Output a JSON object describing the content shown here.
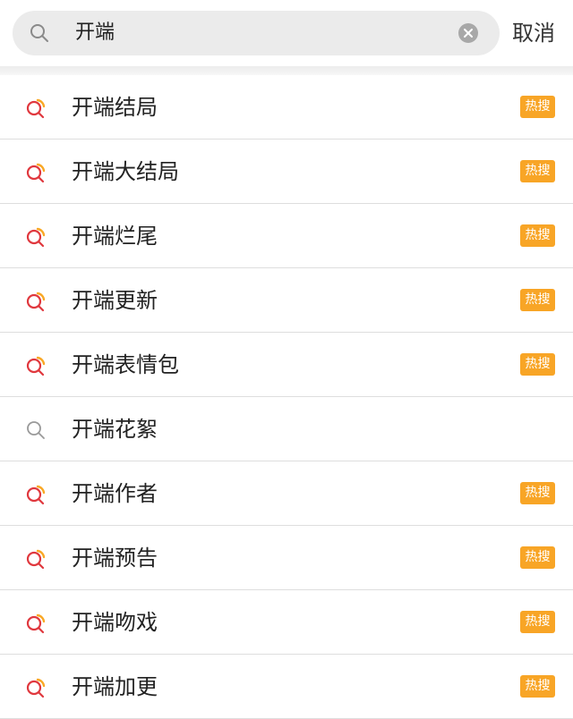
{
  "search": {
    "value": "开端",
    "cancel_label": "取消"
  },
  "colors": {
    "hot_badge": "#f8a526",
    "hot_icon_red": "#e0383e",
    "hot_icon_orange": "#f9a825",
    "plain_icon": "#999999"
  },
  "suggestions": [
    {
      "label": "开端结局",
      "hot": true,
      "badge": "热搜",
      "icon": "hot-search-icon"
    },
    {
      "label": "开端大结局",
      "hot": true,
      "badge": "热搜",
      "icon": "hot-search-icon"
    },
    {
      "label": "开端烂尾",
      "hot": true,
      "badge": "热搜",
      "icon": "hot-search-icon"
    },
    {
      "label": "开端更新",
      "hot": true,
      "badge": "热搜",
      "icon": "hot-search-icon"
    },
    {
      "label": "开端表情包",
      "hot": true,
      "badge": "热搜",
      "icon": "hot-search-icon"
    },
    {
      "label": "开端花絮",
      "hot": false,
      "badge": "",
      "icon": "search-icon"
    },
    {
      "label": "开端作者",
      "hot": true,
      "badge": "热搜",
      "icon": "hot-search-icon"
    },
    {
      "label": "开端预告",
      "hot": true,
      "badge": "热搜",
      "icon": "hot-search-icon"
    },
    {
      "label": "开端吻戏",
      "hot": true,
      "badge": "热搜",
      "icon": "hot-search-icon"
    },
    {
      "label": "开端加更",
      "hot": true,
      "badge": "热搜",
      "icon": "hot-search-icon"
    }
  ]
}
